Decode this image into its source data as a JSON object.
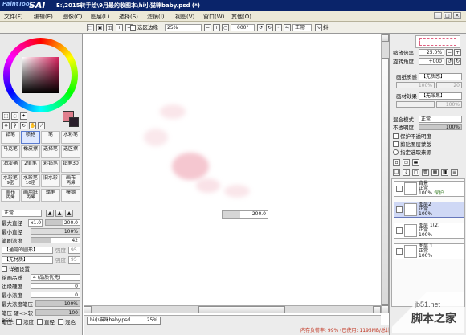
{
  "title": {
    "logo_small": "PaintTool",
    "logo_big": "SAI",
    "text": "E:\\2015转手绘\\9月最的收图本\\hi小猫咪baby.psd (*)"
  },
  "menu": [
    {
      "label": "文件(F)"
    },
    {
      "label": "编辑(E)"
    },
    {
      "label": "图像(C)"
    },
    {
      "label": "图层(L)"
    },
    {
      "label": "选择(S)"
    },
    {
      "label": "滤镜(I)"
    },
    {
      "label": "视图(V)"
    },
    {
      "label": "窗口(W)"
    },
    {
      "label": "其他(O)"
    }
  ],
  "toolbar": {
    "checkbox_label": "选区边缘",
    "zoom": "25%",
    "rotation": "+000°",
    "mode": "正常",
    "stabilizer_label": "抖"
  },
  "left": {
    "brush_tools": [
      {
        "name": "铅笔",
        "size": ""
      },
      {
        "name": "喷枪",
        "size": ""
      },
      {
        "name": "笔",
        "size": ""
      },
      {
        "name": "水彩笔",
        "size": ""
      },
      {
        "name": "马克笔",
        "size": ""
      },
      {
        "name": "橡皮擦",
        "size": ""
      },
      {
        "name": "选择笔",
        "size": ""
      },
      {
        "name": "选区擦",
        "size": ""
      },
      {
        "name": "油漆桶",
        "size": ""
      },
      {
        "name": "2值笔",
        "size": ""
      },
      {
        "name": "彩铅笔",
        "size": ""
      },
      {
        "name": "铅笔30",
        "size": ""
      },
      {
        "name": "水彩笔",
        "size": "9密"
      },
      {
        "name": "水彩笔",
        "size": "10密"
      },
      {
        "name": "旧水彩",
        "size": ""
      },
      {
        "name": "画布",
        "size": "丙烯"
      },
      {
        "name": "画布",
        "size": "丙烯"
      },
      {
        "name": "画用纸",
        "size": "丙烯"
      },
      {
        "name": "蜡笔",
        "size": ""
      },
      {
        "name": "模糊",
        "size": ""
      }
    ],
    "blend_mode": "正常",
    "max_size_label": "最大直径",
    "max_size_mult": "x1.0",
    "max_size_value": "200.0",
    "min_size_label": "最小直径",
    "min_size_value": "100%",
    "density_label": "笔刷浓度",
    "density_value": "42",
    "shape_label": "【通常的圆形】",
    "shape_strength_label": "强度",
    "shape_strength_value": "95",
    "texture_label": "【无材质】",
    "texture_strength_label": "强度",
    "texture_strength_value": "95",
    "detail_label": "详细设置",
    "quality_label": "绘画品质",
    "quality_value": "4 (品质优先)",
    "edge_hardness_label": "边缘硬度",
    "edge_hardness_value": "0",
    "min_density_label": "最小浓度",
    "min_density_value": "0",
    "max_pressure_label": "最大浓度笔压",
    "max_pressure_value": "100%",
    "pressure_hardness_label": "笔压 硬<>软",
    "pressure_hardness_value": "100",
    "pressure_label": "笔压:",
    "pressure_density": "浓度",
    "pressure_size": "直径",
    "pressure_mix": "混色",
    "zoom_pct": "25%"
  },
  "canvas": {
    "size_value": "200.0",
    "file_tab": "hi小猫咪baby.psd",
    "file_tab_zoom": "25%",
    "memory": "内存负荷率: 99% (已使用: 1195MB/总计: 4095MB)"
  },
  "right": {
    "nav_zoom_label": "缩放倍率",
    "nav_zoom_value": "25.0%",
    "nav_rotate_label": "旋转角度",
    "nav_rotate_value": "+000",
    "paper_texture_label": "画纸质感",
    "paper_texture_value": "【无质感】",
    "paper_texture_scale": "100%",
    "paper_texture_strength": "20",
    "paper_effect_label": "画材效果",
    "paper_effect_value": "【无效果】",
    "paper_effect_strength": "100%",
    "blend_label": "混合模式",
    "blend_value": "正常",
    "opacity_label": "不透明度",
    "opacity_value": "100%",
    "protect_label": "保护不透明度",
    "clip_label": "剪贴图层蒙版",
    "selection_source_label": "指定选取来源",
    "layers": [
      {
        "name": "背景",
        "mode": "正常",
        "opacity": "100%",
        "extra": "保护"
      },
      {
        "name": "图层2",
        "mode": "正常",
        "opacity": "100%",
        "extra": ""
      },
      {
        "name": "图层 1(2)",
        "mode": "正常",
        "opacity": "100%",
        "extra": ""
      },
      {
        "name": "图层 1",
        "mode": "正常",
        "opacity": "100%",
        "extra": ""
      }
    ]
  },
  "watermark": {
    "url": "jb51.net",
    "name": "脚本之家"
  },
  "colors": {
    "foreground": "#e07f8d",
    "background": "#2a1f2b",
    "titlebar": "#0a246a"
  }
}
